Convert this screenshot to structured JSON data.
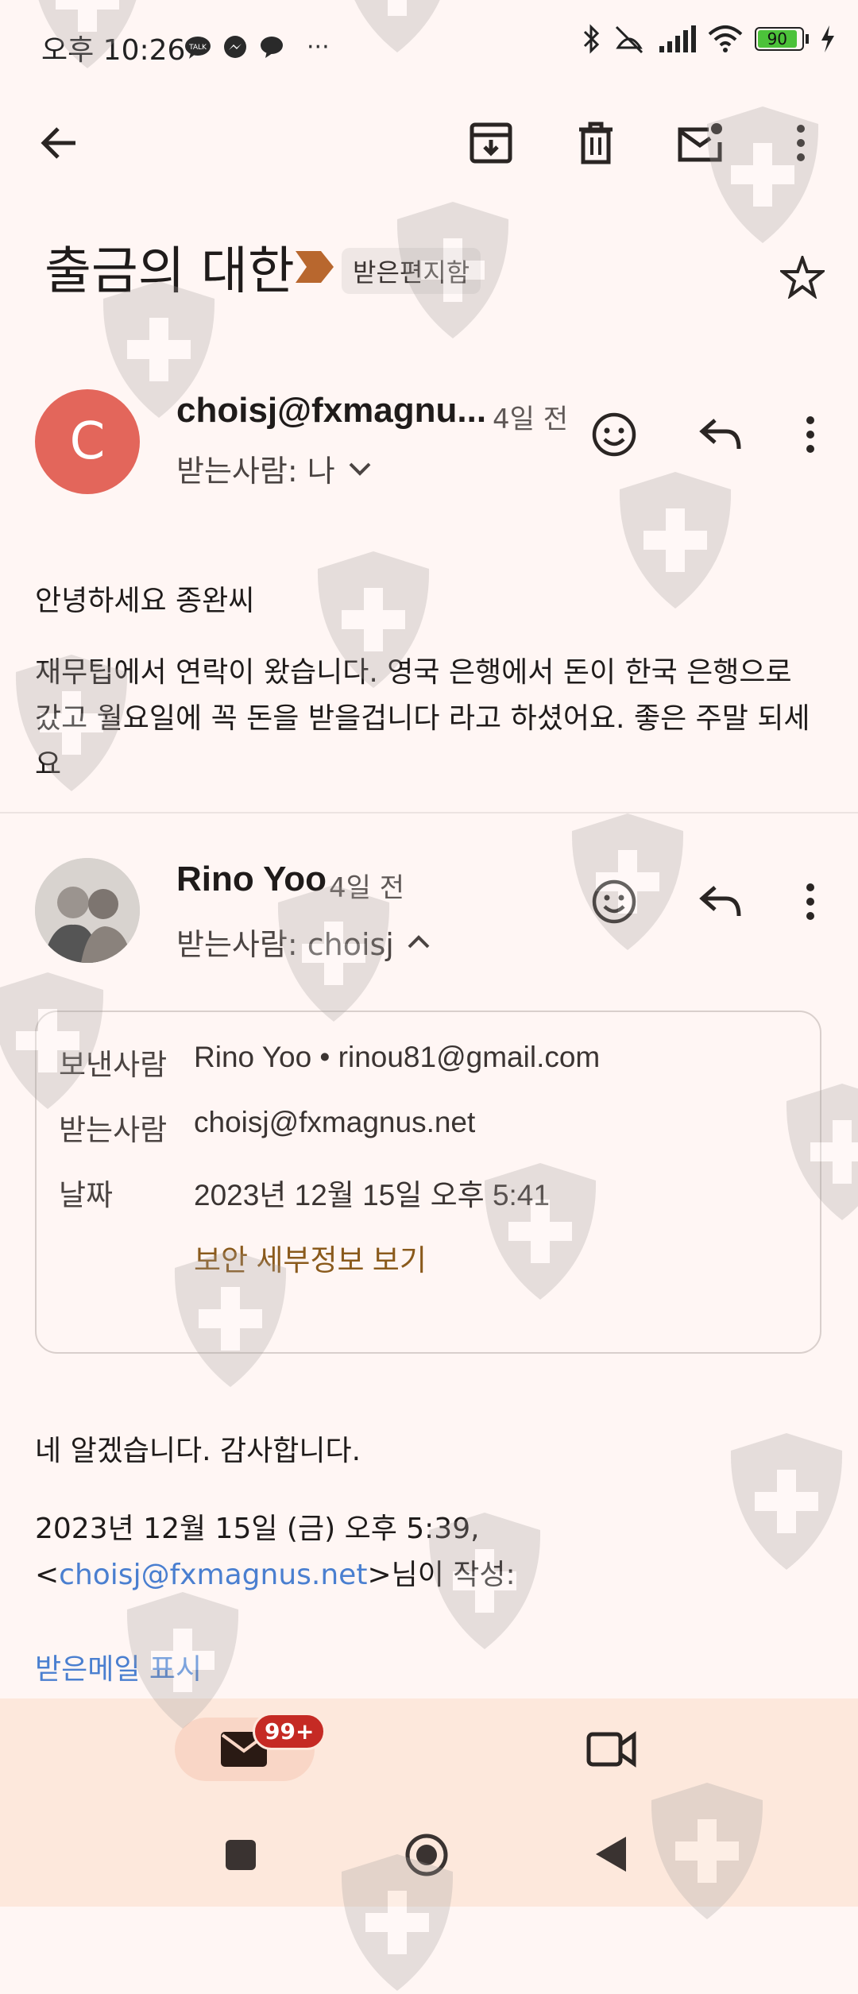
{
  "status_bar": {
    "time": "오후 10:26",
    "battery": "90",
    "more_dots": "···"
  },
  "thread": {
    "subject": "출금의 대한",
    "label": "받은편지함"
  },
  "message1": {
    "avatar_letter": "C",
    "sender": "choisj@fxmagnu...",
    "time": "4일 전",
    "recipient": "받는사람: 나",
    "greeting": "안녕하세요 종완씨",
    "body": "재무팁에서 연락이 왔습니다. 영국 은행에서 돈이 한국 은행으로 갔고 월요일에 꼭 돈을 받을겁니다 라고 하셨어요. 좋은 주말 되세요"
  },
  "message2": {
    "sender": "Rino Yoo",
    "time": "4일 전",
    "recipient": "받는사람: choisj",
    "details": {
      "from_label": "보낸사람",
      "from_value": "Rino Yoo • rinou81@gmail.com",
      "to_label": "받는사람",
      "to_value": "choisj@fxmagnus.net",
      "date_label": "날짜",
      "date_value": "2023년 12월 15일 오후 5:41",
      "security_link": "보안 세부정보 보기"
    },
    "reply": "네 알겠습니다. 감사합니다.",
    "quote_prefix": "2023년 12월 15일 (금) 오후 5:39, <",
    "quote_email": "choisj@fxmagnus.net",
    "quote_suffix": ">님이 작성:",
    "show_quoted": "받은메일 표시"
  },
  "bottom_nav": {
    "mail_badge": "99+"
  },
  "colors": {
    "background": "#fff6f4",
    "avatar": "#e3665b",
    "label_arrow": "#b8672e",
    "link": "#4a7fd0",
    "badge": "#c52a24"
  }
}
